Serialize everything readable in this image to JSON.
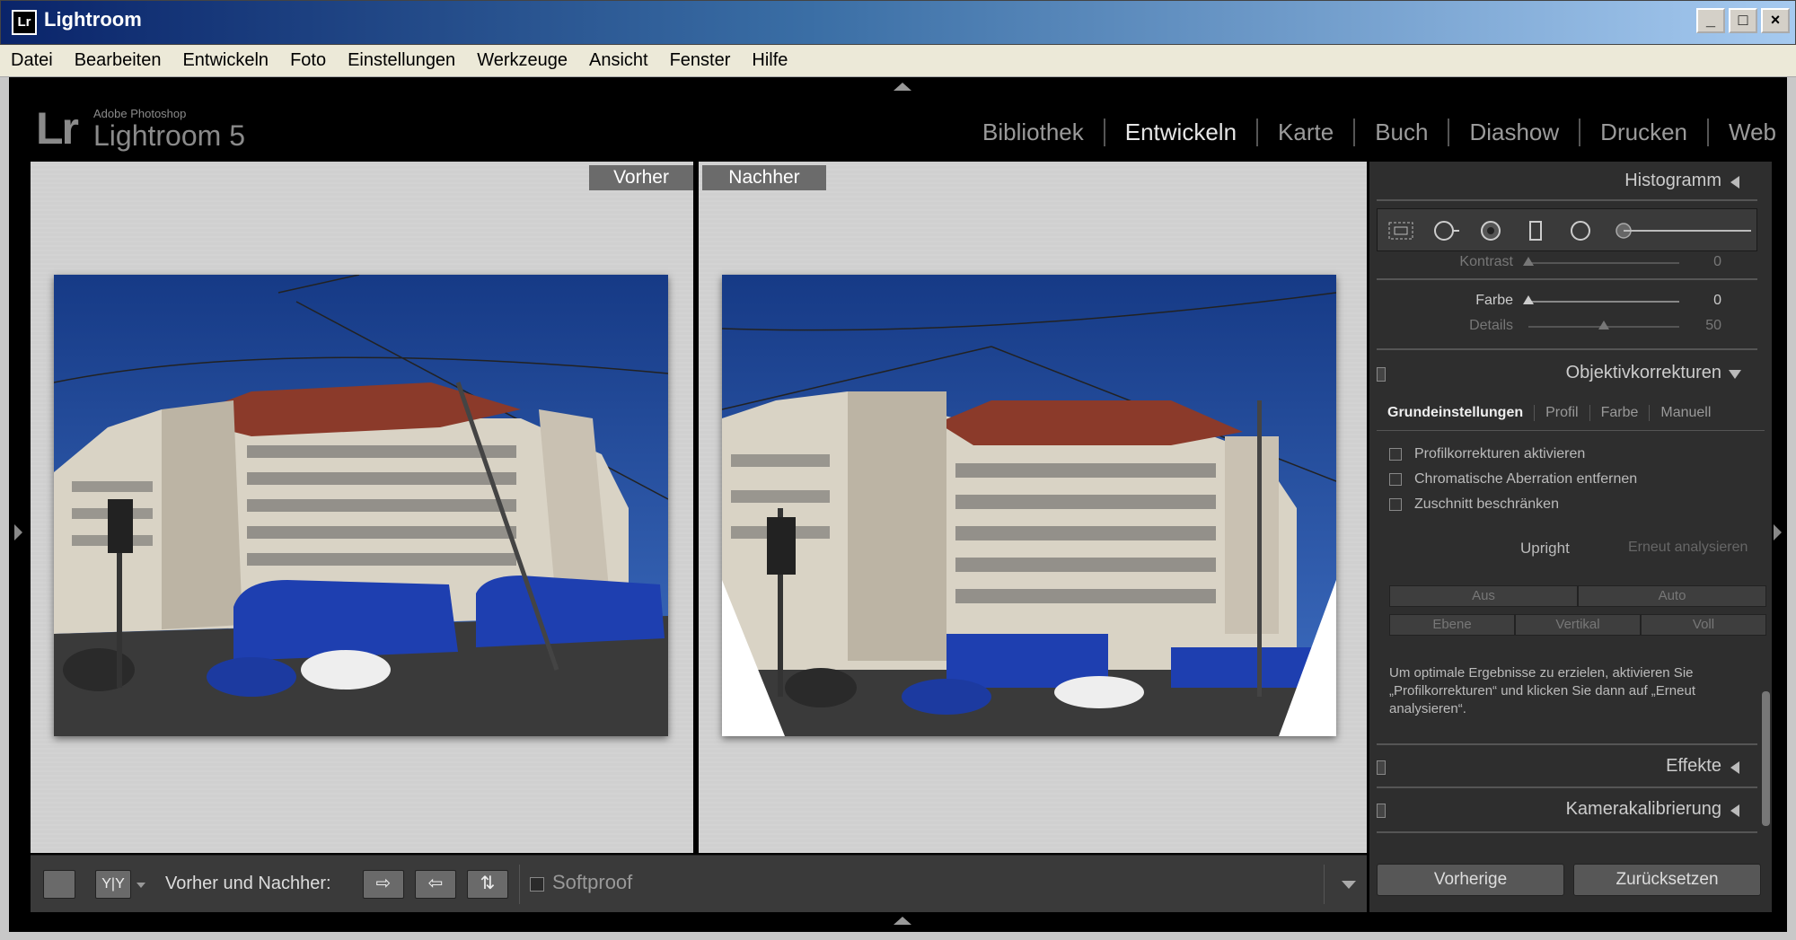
{
  "window": {
    "icon": "Lr",
    "title": "Lightroom",
    "controls": [
      "_",
      "□",
      "×"
    ]
  },
  "menu": [
    "Datei",
    "Bearbeiten",
    "Entwickeln",
    "Foto",
    "Einstellungen",
    "Werkzeuge",
    "Ansicht",
    "Fenster",
    "Hilfe"
  ],
  "logo": {
    "mark": "Lr",
    "small": "Adobe Photoshop",
    "big": "Lightroom 5"
  },
  "modules": [
    {
      "label": "Bibliothek",
      "active": false
    },
    {
      "label": "Entwickeln",
      "active": true
    },
    {
      "label": "Karte",
      "active": false
    },
    {
      "label": "Buch",
      "active": false
    },
    {
      "label": "Diashow",
      "active": false
    },
    {
      "label": "Drucken",
      "active": false
    },
    {
      "label": "Web",
      "active": false
    }
  ],
  "view": {
    "before_label": "Vorher",
    "after_label": "Nachher"
  },
  "toolbar": {
    "compare_label": "Vorher und Nachher:",
    "yy_label": "Y|Y",
    "softproof_label": "Softproof"
  },
  "panel": {
    "histogram": "Histogramm",
    "sliders": [
      {
        "label": "Kontrast",
        "value": "0",
        "dim": true
      },
      {
        "label": "Farbe",
        "value": "0",
        "dim": false
      },
      {
        "label": "Details",
        "value": "50",
        "dim": true
      }
    ],
    "lens_section": "Objektivkorrekturen",
    "subtabs": [
      "Grundeinstellungen",
      "Profil",
      "Farbe",
      "Manuell"
    ],
    "checkboxes": [
      "Profilkorrekturen aktivieren",
      "Chromatische Aberration entfernen",
      "Zuschnitt beschränken"
    ],
    "upright_label": "Upright",
    "reanalyse_label": "Erneut analysieren",
    "upright_buttons_row1": [
      "Aus",
      "Auto"
    ],
    "upright_buttons_row2": [
      "Ebene",
      "Vertikal",
      "Voll"
    ],
    "info": "Um optimale Ergebnisse zu erzielen, aktivieren Sie „Profilkorrekturen“ und klicken Sie dann auf „Erneut analysieren“.",
    "effects_section": "Effekte",
    "calibration_section": "Kamerakalibrierung",
    "btn_previous": "Vorherige",
    "btn_reset": "Zurücksetzen"
  },
  "colors": {
    "sky": "#1f3f8a",
    "building": "#d8d2c4",
    "roof": "#8b3a2a",
    "bus": "#1e3fb0",
    "street": "#3a3a3a"
  }
}
